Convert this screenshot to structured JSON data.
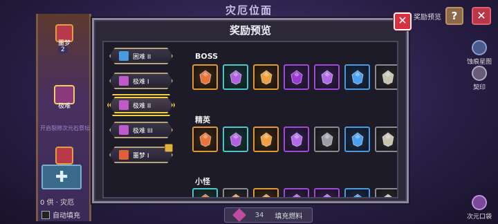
{
  "background": {
    "title": "灾厄位面",
    "reward_preview_label": "奖励预览",
    "help_label": "?",
    "close_label": "✕",
    "node_labels": [
      "噩梦",
      "极难"
    ],
    "node_count": "2",
    "hint_text": "开启裂隙次元石祭坛",
    "currency_text": "0 供 · 灾厄",
    "auto_fill_label": "自动填充",
    "fill_button": {
      "count": "34",
      "label": "填充燃料"
    },
    "side_items": [
      "蚀痕星图",
      "契印",
      "次元口袋"
    ]
  },
  "modal": {
    "title": "奖励预览",
    "close_label": "✕",
    "difficulties": [
      {
        "label": "困难 II",
        "icon_color": "#4a9ae0",
        "active": false,
        "locked": false
      },
      {
        "label": "极难 I",
        "icon_color": "#c05ac8",
        "active": false,
        "locked": false
      },
      {
        "label": "极难 II",
        "icon_color": "#c05ac8",
        "active": true,
        "locked": false
      },
      {
        "label": "极难 III",
        "icon_color": "#c05ac8",
        "active": false,
        "locked": false
      },
      {
        "label": "噩梦 I",
        "icon_color": "#e0603a",
        "active": false,
        "locked": true
      }
    ],
    "sections": [
      {
        "title": "BOSS",
        "items": [
          {
            "icon": "fire-crystal-icon",
            "rarity": "orange",
            "color": "#e8743a"
          },
          {
            "icon": "purple-orb-icon",
            "rarity": "cyan",
            "color": "#b060e0"
          },
          {
            "icon": "amber-gem-icon",
            "rarity": "orange",
            "color": "#f0a040"
          },
          {
            "icon": "purple-swirl-icon",
            "rarity": "purple",
            "color": "#9a3ad0"
          },
          {
            "icon": "violet-gem-icon",
            "rarity": "purple",
            "color": "#b06ae8"
          },
          {
            "icon": "blue-gem-icon",
            "rarity": "blue",
            "color": "#4aa0f0"
          },
          {
            "icon": "stone-icon",
            "rarity": "gray",
            "color": "#c8c4b0"
          }
        ]
      },
      {
        "title": "精英",
        "items": [
          {
            "icon": "fire-crystal-icon",
            "rarity": "orange",
            "color": "#e8743a"
          },
          {
            "icon": "purple-orb-icon",
            "rarity": "cyan",
            "color": "#b060e0"
          },
          {
            "icon": "amber-gem-icon",
            "rarity": "orange",
            "color": "#f0a040"
          },
          {
            "icon": "violet-gem-icon",
            "rarity": "purple",
            "color": "#b06ae8"
          },
          {
            "icon": "ore-icon",
            "rarity": "gray",
            "color": "#9aa0a8"
          },
          {
            "icon": "blue-gem-icon",
            "rarity": "blue",
            "color": "#4aa0f0"
          },
          {
            "icon": "stone-icon",
            "rarity": "gray",
            "color": "#c8c4b0"
          }
        ]
      },
      {
        "title": "小怪",
        "items": [
          {
            "icon": "fire-crystal-icon",
            "rarity": "cyan",
            "color": "#e8743a"
          },
          {
            "icon": "amber-gem-icon",
            "rarity": "gray",
            "color": "#f0a040"
          },
          {
            "icon": "amber-gem-icon",
            "rarity": "orange",
            "color": "#f0a040"
          },
          {
            "icon": "violet-gem-icon",
            "rarity": "purple",
            "color": "#b06ae8"
          },
          {
            "icon": "violet-gem-icon",
            "rarity": "purple",
            "color": "#b06ae8"
          },
          {
            "icon": "blue-gem-icon",
            "rarity": "blue",
            "color": "#4aa0f0"
          },
          {
            "icon": "stone-icon",
            "rarity": "gray",
            "color": "#c8c4b0"
          }
        ]
      }
    ]
  }
}
